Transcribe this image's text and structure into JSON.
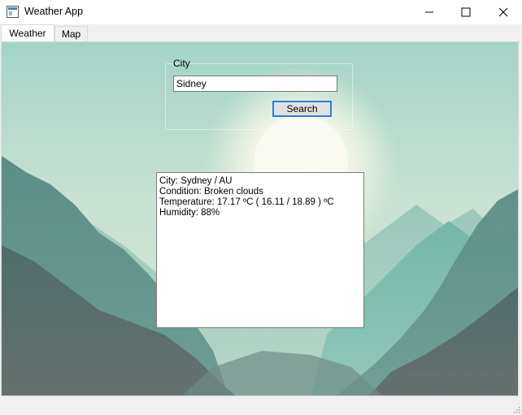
{
  "window": {
    "title": "Weather App",
    "icon": "app-window-icon"
  },
  "tabs": [
    {
      "label": "Weather",
      "active": true
    },
    {
      "label": "Map",
      "active": false
    }
  ],
  "search": {
    "group_label": "City",
    "input_value": "Sidney",
    "button_label": "Search"
  },
  "result": {
    "lines": [
      "City: Sydney / AU",
      "Condition: Broken clouds",
      "Temperature: 17.17 ºC ( 16.11 / 18.89 ) ºC",
      "Humidity: 88%"
    ]
  },
  "colors": {
    "accent": "#2f7fd6",
    "sky_top": "#9ecfc3",
    "mountain_dark": "#5e6e6c"
  }
}
